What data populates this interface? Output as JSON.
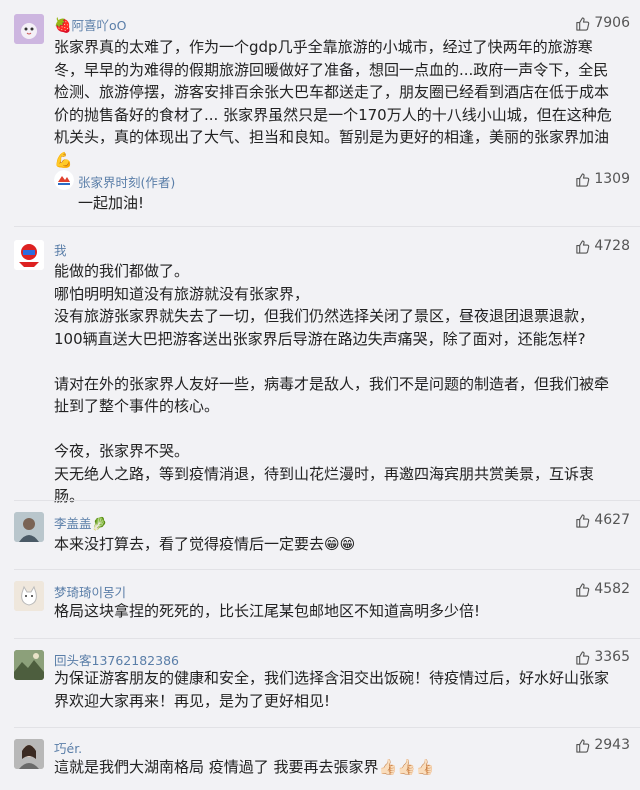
{
  "comments": [
    {
      "name": "阿喜吖oO",
      "likes": "7906",
      "avatar_icon": "bird-avatar-icon",
      "paragraphs": [
        "张家界真的太难了，作为一个gdp几乎全靠旅游的小城市，经过了快两年的旅游寒冬，早早的为难得的假期旅游回暖做好了准备，想回一点血的...政府一声令下，全民检测、旅游停摆，游客安排百余张大巴车都送走了，朋友圈已经看到酒店在低于成本价的抛售备好的食材了... 张家界虽然只是一个170万人的十八线小山城，但在这种危机关头，真的体现出了大气、担当和良知。暂别是为更好的相逢，美丽的张家界加油"
      ],
      "emoji": "💪",
      "reply": {
        "name": "张家界时刻(作者)",
        "text": "一起加油!",
        "likes": "1309"
      }
    },
    {
      "name": "我",
      "likes": "4728",
      "avatar_icon": "robot-avatar-icon",
      "paragraphs": [
        "能做的我们都做了。",
        "哪怕明明知道没有旅游就没有张家界，",
        "没有旅游张家界就失去了一切，但我们仍然选择关闭了景区，昼夜退团退票退款，100辆直送大巴把游客送出张家界后导游在路边失声痛哭，除了面对，还能怎样?",
        "请对在外的张家界人友好一些，病毒才是敌人，我们不是问题的制造者，但我们被牵扯到了整个事件的核心。",
        "今夜，张家界不哭。",
        "天无绝人之路，等到疫情消退，待到山花烂漫时，再邀四海宾朋共赏美景，互诉衷肠。"
      ]
    },
    {
      "name": "李盖盖",
      "likes": "4627",
      "avatar_icon": "person-avatar-icon",
      "paragraphs": [
        "本来没打算去，看了觉得疫情后一定要去"
      ],
      "emoji": "😁😁"
    },
    {
      "name": "梦琦琦이몽기",
      "likes": "4582",
      "avatar_icon": "cat-avatar-icon",
      "paragraphs": [
        "格局这块拿捏的死死的，比长江尾某包邮地区不知道高明多少倍!"
      ]
    },
    {
      "name": "回头客13762182386",
      "likes": "3365",
      "avatar_icon": "scenery-avatar-icon",
      "paragraphs": [
        "为保证游客朋友的健康和安全，我们选择含泪交出饭碗！待疫情过后，好水好山张家界欢迎大家再来！再见，是为了更好相见!"
      ]
    },
    {
      "name": "巧ér.",
      "likes": "2943",
      "avatar_icon": "girl-avatar-icon",
      "paragraphs": [
        "這就是我們大湖南格局 疫情過了 我要再去張家界"
      ],
      "emoji": "👍🏻👍🏻👍🏻"
    }
  ],
  "colors": {
    "background": "#f2f2f5",
    "username": "#5a7ea8",
    "text": "#222222"
  }
}
